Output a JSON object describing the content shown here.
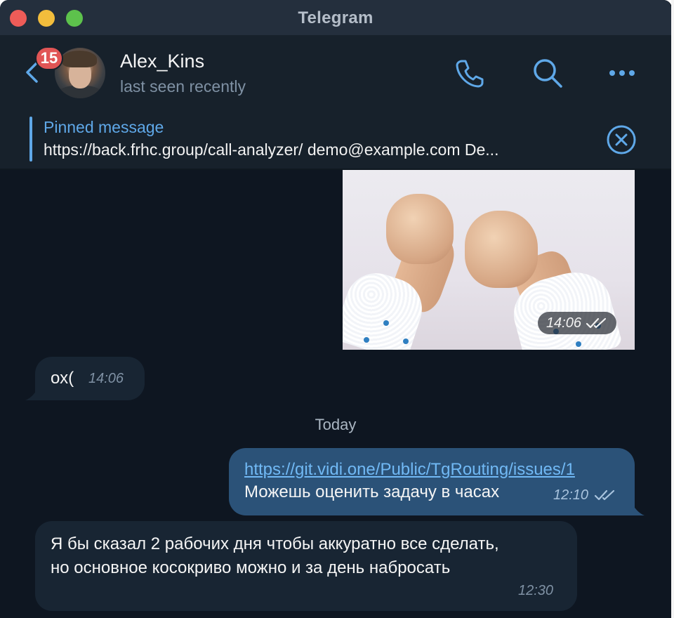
{
  "window": {
    "title": "Telegram"
  },
  "header": {
    "unread_badge": "15",
    "contact_name": "Alex_Kins",
    "contact_status": "last seen recently",
    "icons": [
      "back-arrow-icon",
      "phone-icon",
      "search-icon",
      "more-icon"
    ]
  },
  "pinned": {
    "title": "Pinned message",
    "text": "https://back.frhc.group/call-analyzer/ demo@example.com De..."
  },
  "messages": {
    "photo": {
      "time": "14:06",
      "status": "read"
    },
    "incoming_1": {
      "text": "ох(",
      "time": "14:06"
    },
    "date_separator": "Today",
    "outgoing_1": {
      "link": "https://git.vidi.one/Public/TgRouting/issues/1",
      "text": "Можешь оценить задачу в часах",
      "time": "12:10",
      "status": "read"
    },
    "incoming_2": {
      "line1": "Я бы сказал 2 рабочих дня чтобы аккуратно все сделать,",
      "line2": "но основное косокриво можно и за день набросать",
      "time": "12:30"
    }
  },
  "colors": {
    "background": "#0e1621",
    "header": "#17212b",
    "accent": "#5fa8e8",
    "bubble_in": "#182533",
    "bubble_out": "#2b5278",
    "badge": "#e15555"
  }
}
